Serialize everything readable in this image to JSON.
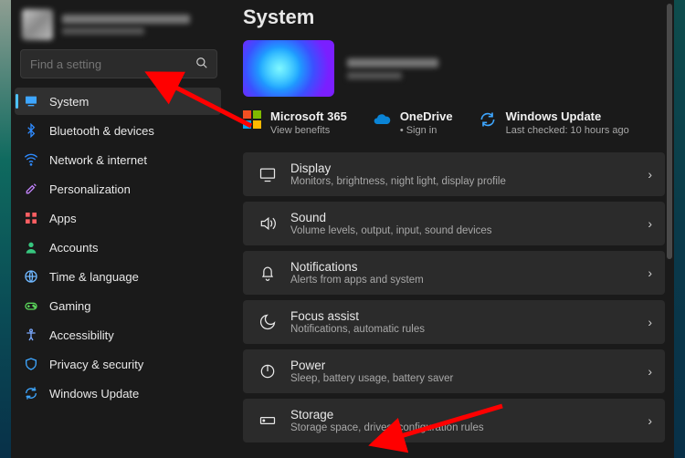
{
  "search": {
    "placeholder": "Find a setting"
  },
  "sidebar": {
    "items": [
      {
        "label": "System"
      },
      {
        "label": "Bluetooth & devices"
      },
      {
        "label": "Network & internet"
      },
      {
        "label": "Personalization"
      },
      {
        "label": "Apps"
      },
      {
        "label": "Accounts"
      },
      {
        "label": "Time & language"
      },
      {
        "label": "Gaming"
      },
      {
        "label": "Accessibility"
      },
      {
        "label": "Privacy & security"
      },
      {
        "label": "Windows Update"
      }
    ]
  },
  "header": {
    "title": "System"
  },
  "tiles": {
    "m365": {
      "title": "Microsoft 365",
      "sub": "View benefits"
    },
    "onedrive": {
      "title": "OneDrive",
      "sub": "• Sign in"
    },
    "wu": {
      "title": "Windows Update",
      "sub": "Last checked: 10 hours ago"
    }
  },
  "rows": {
    "display": {
      "title": "Display",
      "sub": "Monitors, brightness, night light, display profile"
    },
    "sound": {
      "title": "Sound",
      "sub": "Volume levels, output, input, sound devices"
    },
    "notifications": {
      "title": "Notifications",
      "sub": "Alerts from apps and system"
    },
    "focus": {
      "title": "Focus assist",
      "sub": "Notifications, automatic rules"
    },
    "power": {
      "title": "Power",
      "sub": "Sleep, battery usage, battery saver"
    },
    "storage": {
      "title": "Storage",
      "sub": "Storage space, drives, configuration rules"
    }
  }
}
